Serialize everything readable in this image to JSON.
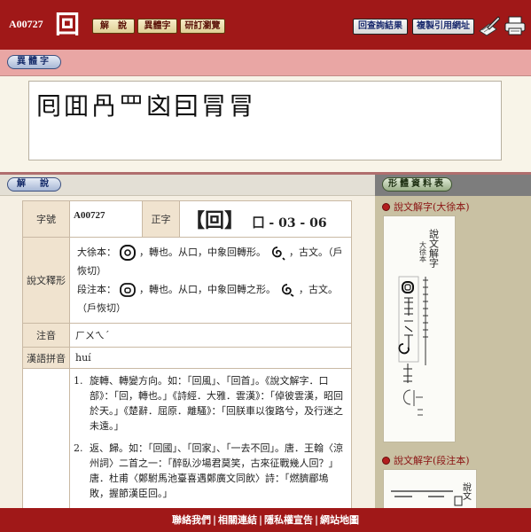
{
  "header": {
    "char_id": "A00727",
    "char": "回",
    "nav": [
      {
        "label": "解　說"
      },
      {
        "label": "異體字"
      },
      {
        "label": "研訂瀏覽"
      }
    ],
    "actions": [
      {
        "label": "回查詢結果"
      },
      {
        "label": "複製引用網址"
      }
    ]
  },
  "variants": {
    "tab_label": "異體字",
    "chars": "囘囬冎罒㓙囙冐冐𠠵"
  },
  "explanation": {
    "tab_label": "解　說",
    "id_label": "字號",
    "id_value": "A00727",
    "char_label": "正字",
    "char_bracket": "【回】",
    "radical_info": "囗 - 03 - 06",
    "shuowen_label": "說文釋形",
    "shuowen_da": {
      "prefix": "大徐本：",
      "text": "，轉也。从口，中象回轉形。",
      "guwen": "，古文。（戶恢切）"
    },
    "shuowen_duan": {
      "prefix": "段注本：",
      "text": "，轉也。从口，中象回轉之形。",
      "guwen": "，古文。（戶恢切）"
    },
    "zhuyin_label": "注音",
    "zhuyin_value": "ㄏㄨㄟˊ",
    "pinyin_label": "漢語拼音",
    "pinyin_value": "huí",
    "definitions": [
      {
        "num": "1.",
        "text": "旋轉、轉變方向。如：「回風」、「回首」。《說文解字．口部》：「回，轉也。」《詩經．大雅．雲漢》：「倬彼雲漢，昭回於天。」《楚辭．屈原．離騷》：「回朕車以復路兮，及行迷之未遠。」"
      },
      {
        "num": "2.",
        "text": "返、歸。如：「回國」、「回家」、「一去不回」。唐．王翰〈涼州詞〉二首之一：「醉臥沙場君莫笑，古來征戰幾人回？」唐．杜甫〈鄭駙馬池臺喜遇鄭廣文同飲〉詩：「燃臍郿塢敗，握節漢臣回。」"
      }
    ]
  },
  "sidebar": {
    "tab_label": "形體資料表",
    "resources": [
      {
        "title": "說文解字(大徐本)"
      },
      {
        "title": "說文解字(段注本)"
      }
    ],
    "scan_text_1": "說文解字",
    "scan_text_2": "大徐本"
  },
  "footer": {
    "links": [
      "聯絡我們",
      "相關連結",
      "隱私權宣告",
      "網站地圖"
    ],
    "separator": "|"
  }
}
